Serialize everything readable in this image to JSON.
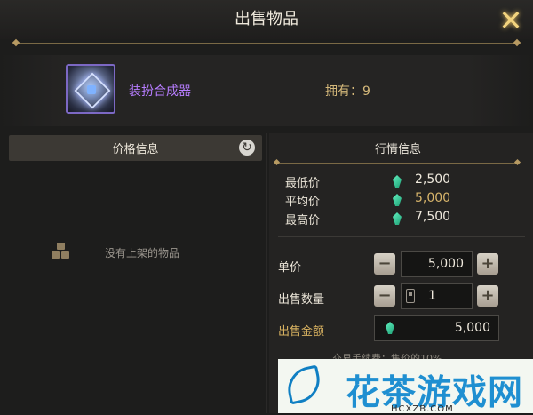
{
  "title": "出售物品",
  "item": {
    "name": "装扮合成器",
    "owned": "拥有：9"
  },
  "left_panel": {
    "header": "价格信息",
    "empty_text": "没有上架的物品"
  },
  "market": {
    "title": "行情信息",
    "rows": [
      {
        "label": "最低价",
        "value": "2,500"
      },
      {
        "label": "平均价",
        "value": "5,000"
      },
      {
        "label": "最高价",
        "value": "7,500"
      }
    ]
  },
  "form": {
    "unit_price_label": "单价",
    "unit_price": "5,000",
    "quantity_label": "出售数量",
    "quantity": "1",
    "total_label": "出售金额",
    "total": "5,000",
    "fee_note": "交易手续费：售价的10%"
  },
  "watermark": {
    "text": "花茶游戏网",
    "url": "HCXZB.COM"
  },
  "colors": {
    "background": "#1d1d1c",
    "item_name": "#b77dff",
    "gold": "#d6b060",
    "watermark": "#1f8fd1"
  },
  "icons": [
    "close-icon",
    "item-icon",
    "refresh-icon",
    "empty-box-icon",
    "gem-icon",
    "minus-icon",
    "plus-icon",
    "quantity-icon"
  ]
}
